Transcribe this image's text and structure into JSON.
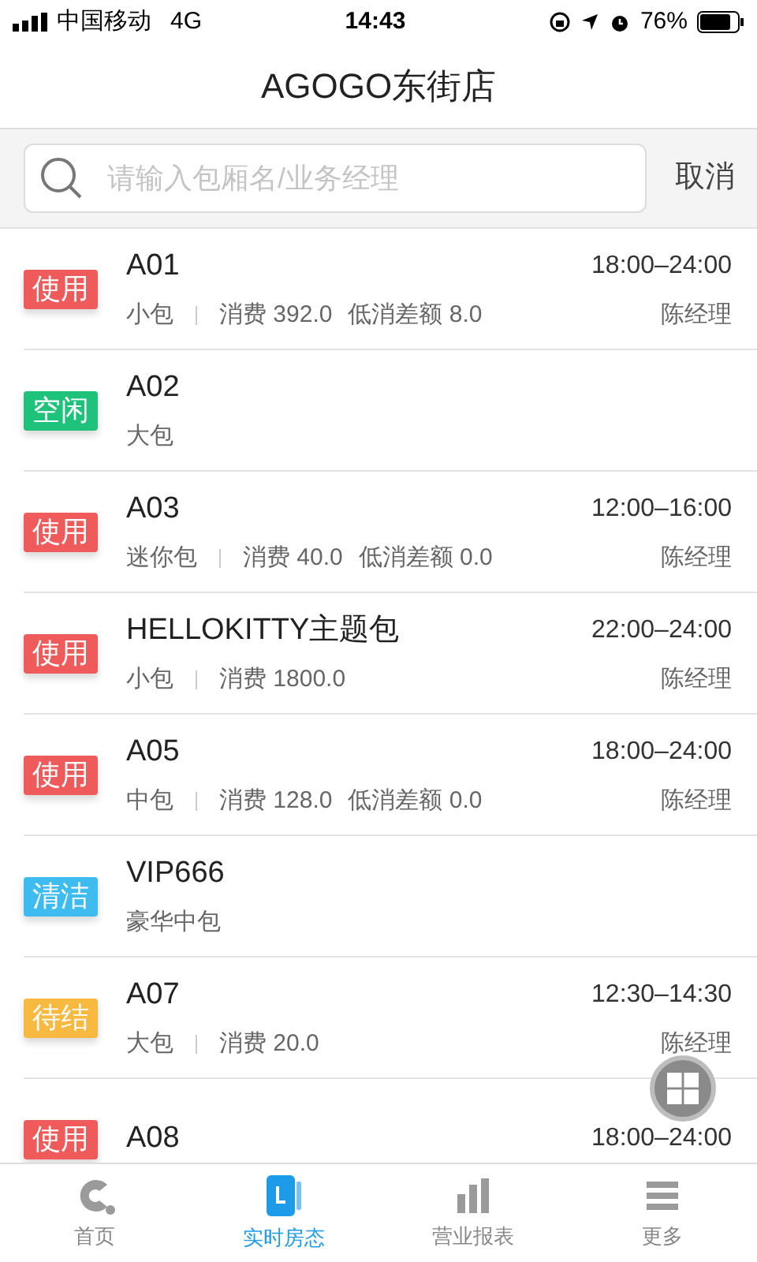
{
  "status_bar": {
    "carrier": "中国移动",
    "network": "4G",
    "time": "14:43",
    "battery": "76%"
  },
  "nav": {
    "title": "AGOGO东街店"
  },
  "search": {
    "placeholder": "请输入包厢名/业务经理",
    "cancel": "取消"
  },
  "rooms": [
    {
      "status": "使用",
      "color": "#ef5b5b",
      "name": "A01",
      "time": "18:00–24:00",
      "size": "小包",
      "spend": "消费 392.0",
      "shortfall": "低消差额 8.0",
      "manager": "陈经理"
    },
    {
      "status": "空闲",
      "color": "#1fc27a",
      "name": "A02",
      "size": "大包"
    },
    {
      "status": "使用",
      "color": "#ef5b5b",
      "name": "A03",
      "time": "12:00–16:00",
      "size": "迷你包",
      "spend": "消费 40.0",
      "shortfall": "低消差额 0.0",
      "manager": "陈经理"
    },
    {
      "status": "使用",
      "color": "#ef5b5b",
      "name": "HELLOKITTY主题包",
      "time": "22:00–24:00",
      "size": "小包",
      "spend": "消费 1800.0",
      "manager": "陈经理"
    },
    {
      "status": "使用",
      "color": "#ef5b5b",
      "name": "A05",
      "time": "18:00–24:00",
      "size": "中包",
      "spend": "消费 128.0",
      "shortfall": "低消差额 0.0",
      "manager": "陈经理"
    },
    {
      "status": "清洁",
      "color": "#3ebcf0",
      "name": "VIP666",
      "size": "豪华中包"
    },
    {
      "status": "待结",
      "color": "#f7b940",
      "name": "A07",
      "time": "12:30–14:30",
      "size": "大包",
      "spend": "消费 20.0",
      "manager": "陈经理"
    },
    {
      "status": "使用",
      "color": "#ef5b5b",
      "name": "A08",
      "time": "18:00–24:00"
    }
  ],
  "tabs": [
    {
      "label": "首页",
      "selected": false,
      "kind": "home"
    },
    {
      "label": "实时房态",
      "selected": true,
      "kind": "rooms"
    },
    {
      "label": "营业报表",
      "selected": false,
      "kind": "report"
    },
    {
      "label": "更多",
      "selected": false,
      "kind": "more"
    }
  ]
}
